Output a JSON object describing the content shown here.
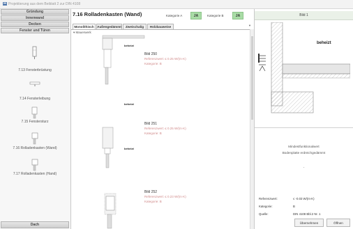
{
  "window": {
    "title": "Projektierung aus dem Beiblatt 2 zur DIN 4108"
  },
  "sidebar": {
    "nav_top": [
      {
        "label": "Gründung"
      },
      {
        "label": "Innenwand"
      },
      {
        "label": "Decken"
      },
      {
        "label": "Fenster und Türen"
      }
    ],
    "items": [
      {
        "label": "7.13 Fensterbrüstung"
      },
      {
        "label": "7.14 Fensterleibung"
      },
      {
        "label": "7.15 Fenstersturz"
      },
      {
        "label": "7.16 Rolladenkasten (Wand)"
      },
      {
        "label": "7.17 Rolladenkasten (Hand)"
      }
    ],
    "nav_bottom": {
      "label": "Dach"
    }
  },
  "center": {
    "title": "7.16 Rolladenkasten (Wand)",
    "kat_a_label": "Kategorie A",
    "kat_a_value": "JA",
    "kat_b_label": "Kategorie B",
    "kat_b_value": "JA",
    "tabs": [
      "Monolithisch",
      "Außengedämmt",
      "Zweischalig",
      "Holzbauweise"
    ],
    "group": "Mauerwerk",
    "details": [
      {
        "title": "Bild 250",
        "line1": "Referenzwert: ≤ 0.25 W/(m·K)",
        "line2": "Kategorie: B",
        "label_top": "beheizt",
        "label_mid": "beheizt"
      },
      {
        "title": "Bild 251",
        "line1": "Referenzwert: ≤ 0.25 W/(m·K)",
        "line2": "Kategorie: B",
        "label_top": "",
        "label_mid": "beheizt"
      },
      {
        "title": "Bild 252",
        "line1": "Referenzwert: ≤ 0.23 W/(m·K)",
        "line2": "Kategorie: B",
        "label_top": "beheizt",
        "label_mid": ""
      }
    ]
  },
  "right": {
    "header": "Bild 1",
    "drawing_label": "beheizt",
    "block_title": "Mindestfunktionalwert",
    "block_sub": "Bodenplatte erdreichgedämmt",
    "block_dash": "-",
    "fields": [
      {
        "label": "Referenzwert:",
        "value": "≤ -0.03 W/(m·K)"
      },
      {
        "label": "Kategorie:",
        "value": "B"
      },
      {
        "label": "Quelle:",
        "value": "DIN 4108 Bbl.2 Nr. 1"
      }
    ],
    "buttons": {
      "accept": "Übernehmen",
      "open": "Öffnen"
    }
  },
  "colors": {
    "accent_green": "#a9dca6",
    "note_red": "#d08a8a",
    "header_green": "#eaf1e8"
  }
}
